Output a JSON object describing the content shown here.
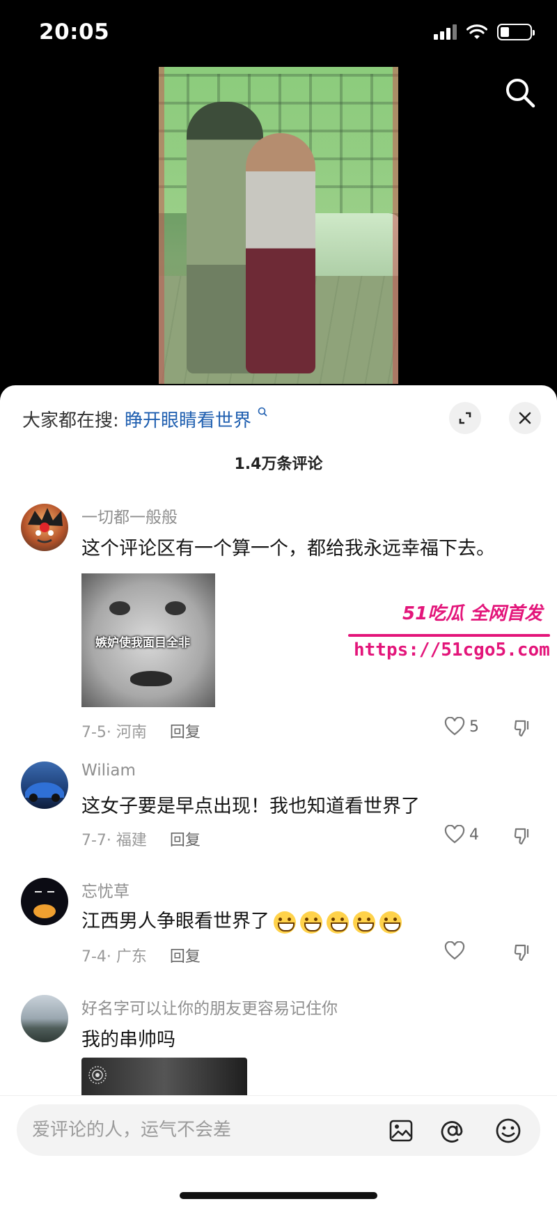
{
  "status_bar": {
    "time": "20:05"
  },
  "hot_search": {
    "prefix": "大家都在搜:",
    "keyword": "睁开眼睛看世界"
  },
  "comments_count": "1.4万条评论",
  "comments": [
    {
      "user": "一切都一般般",
      "text": "这个评论区有一个算一个，都给我永远幸福下去。",
      "sticker_caption": "嫉妒使我面目全非",
      "meta": "7-5· 河南",
      "reply": "回复",
      "likes": "5"
    },
    {
      "user": "Wiliam",
      "text": "这女子要是早点出现！我也知道看世界了",
      "meta": "7-7· 福建",
      "reply": "回复",
      "likes": "4"
    },
    {
      "user": "忘忧草",
      "text": "江西男人争眼看世界了",
      "meta": "7-4· 广东",
      "reply": "回复",
      "likes": ""
    },
    {
      "user": "好名字可以让你的朋友更容易记住你",
      "text": "我的串帅吗"
    }
  ],
  "watermark": {
    "brand": "51吃瓜 全网首发",
    "url": "https://51cgo5.com"
  },
  "input": {
    "placeholder": "爱评论的人，运气不会差"
  },
  "icons": [
    "search-icon",
    "expand-icon",
    "close-icon",
    "heart-icon",
    "dislike-icon",
    "image-icon",
    "at-icon",
    "emoji-icon"
  ]
}
